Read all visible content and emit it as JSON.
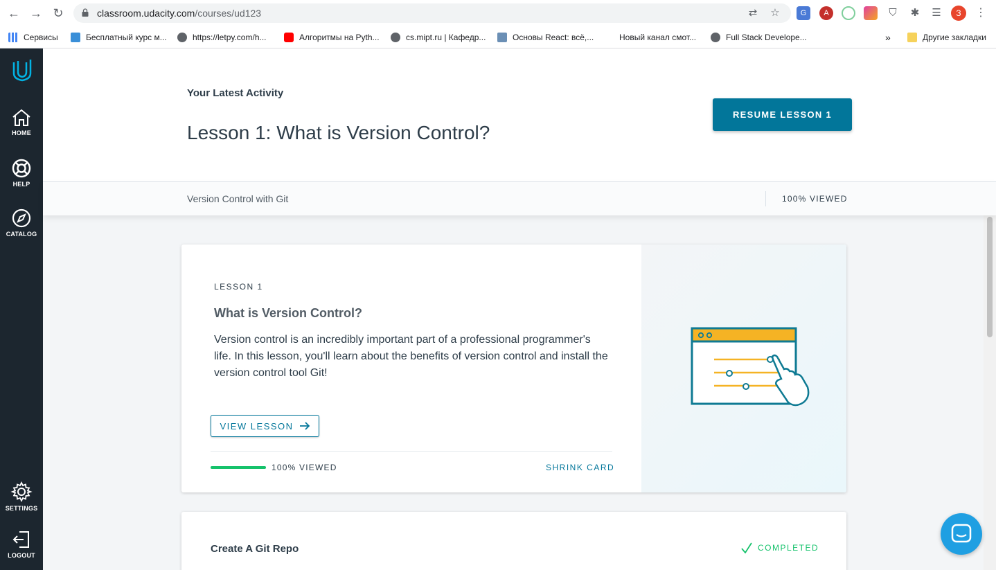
{
  "browser": {
    "url_host": "classroom.udacity.com",
    "url_path": "/courses/ud123",
    "profile_initial": "З",
    "bookmarks": [
      {
        "label": "Сервисы",
        "icon": "apps-grid-icon"
      },
      {
        "label": "Бесплатный курс м...",
        "icon": "stepik-icon"
      },
      {
        "label": "https://letpy.com/h...",
        "icon": "globe-icon"
      },
      {
        "label": "Алгоритмы на Pyth...",
        "icon": "youtube-icon"
      },
      {
        "label": "cs.mipt.ru | Кафедр...",
        "icon": "globe-icon"
      },
      {
        "label": "Основы React: всё,...",
        "icon": "bookmark-icon"
      },
      {
        "label": "Новый канал смот...",
        "icon": "blank-icon"
      },
      {
        "label": "Full Stack Develope...",
        "icon": "globe-icon"
      }
    ],
    "more_bookmarks": "»",
    "other_bookmarks": "Другие закладки"
  },
  "sidebar": {
    "items": [
      {
        "label": "HOME",
        "icon": "home-icon"
      },
      {
        "label": "HELP",
        "icon": "lifebuoy-icon"
      },
      {
        "label": "CATALOG",
        "icon": "compass-icon"
      },
      {
        "label": "SETTINGS",
        "icon": "gear-icon"
      },
      {
        "label": "LOGOUT",
        "icon": "logout-icon"
      }
    ]
  },
  "header": {
    "latest_label": "Your Latest Activity",
    "lesson_title": "Lesson 1: What is Version Control?",
    "resume_button": "RESUME LESSON 1"
  },
  "subbar": {
    "course_name": "Version Control with Git",
    "viewed": "100% VIEWED"
  },
  "lesson_card": {
    "label": "LESSON 1",
    "title": "What is Version Control?",
    "description": "Version control is an incredibly important part of a professional programmer's life. In this lesson, you'll learn about the benefits of version control and install the version control tool Git!",
    "view_button": "VIEW LESSON",
    "progress": 1.0,
    "viewed": "100% VIEWED",
    "shrink": "SHRINK CARD",
    "illustration": "browser-window-slider-hand-illustration"
  },
  "next_card": {
    "title": "Create A Git Repo",
    "status": "COMPLETED"
  },
  "colors": {
    "accent": "#02769a",
    "sidebar": "#1c262f",
    "success": "#15c26b",
    "illustration_yellow": "#f5b324",
    "chat": "#1f9fe2"
  }
}
